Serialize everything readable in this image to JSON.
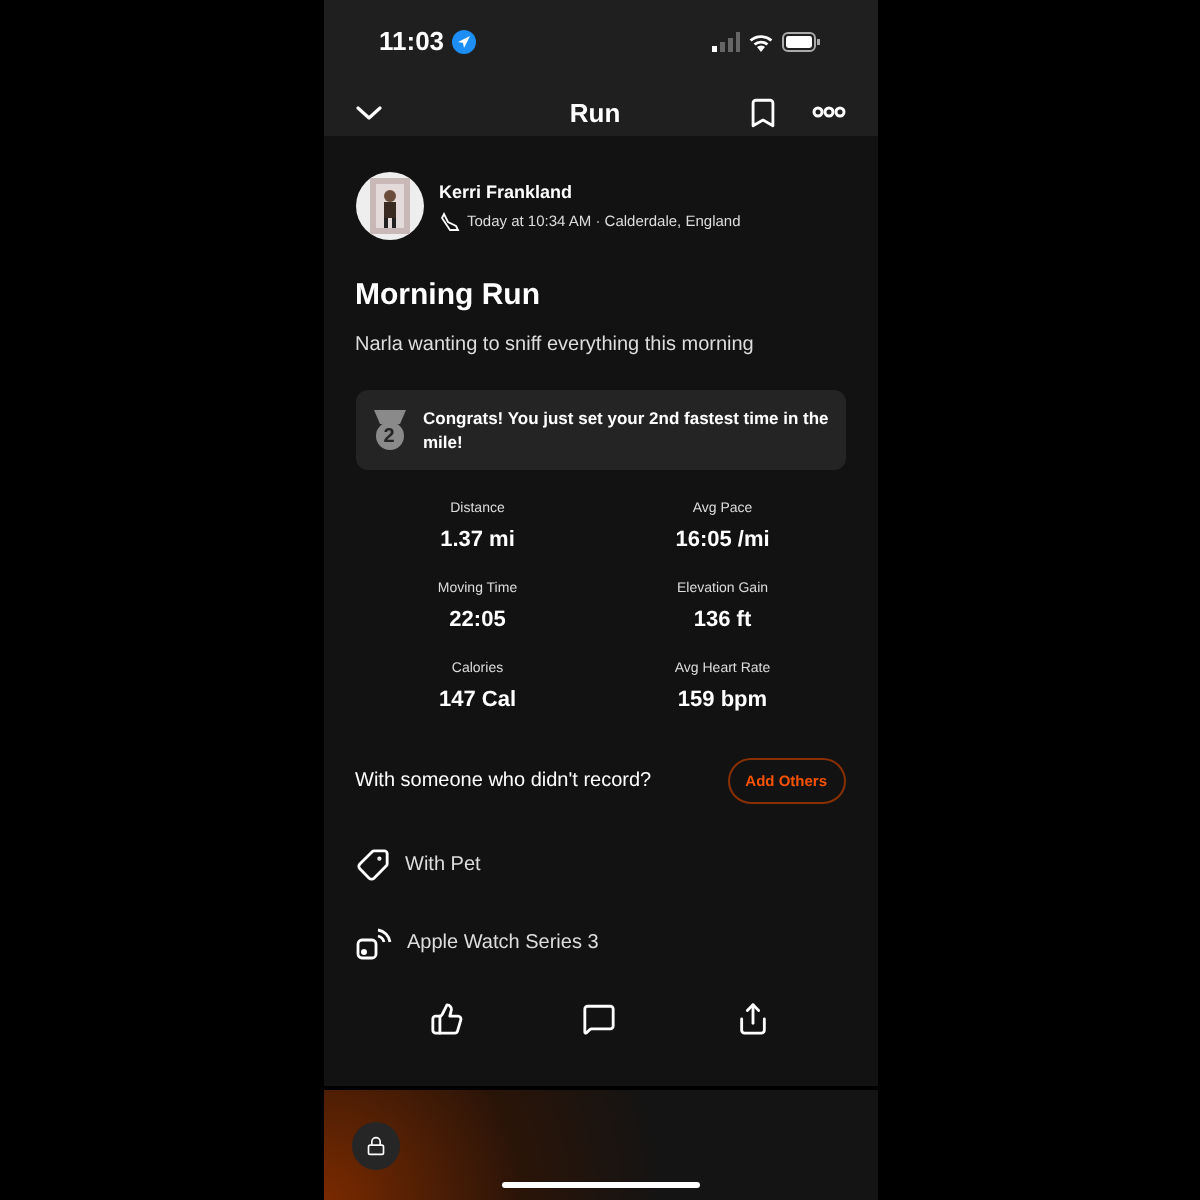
{
  "status_bar": {
    "time": "11:03"
  },
  "header": {
    "title": "Run"
  },
  "athlete": {
    "name": "Kerri Frankland",
    "meta": "Today at 10:34 AM · Calderdale, England"
  },
  "activity": {
    "title": "Morning Run",
    "description": "Narla wanting to sniff everything this morning"
  },
  "achievement": {
    "rank": "2",
    "text": "Congrats! You just set your 2nd fastest time in the mile!"
  },
  "stats": [
    {
      "label": "Distance",
      "value": "1.37 mi"
    },
    {
      "label": "Avg Pace",
      "value": "16:05 /mi"
    },
    {
      "label": "Moving Time",
      "value": "22:05"
    },
    {
      "label": "Elevation Gain",
      "value": "136 ft"
    },
    {
      "label": "Calories",
      "value": "147 Cal"
    },
    {
      "label": "Avg Heart Rate",
      "value": "159 bpm"
    }
  ],
  "add_others": {
    "prompt": "With someone who didn't record?",
    "button": "Add Others"
  },
  "details": [
    {
      "kind": "tag",
      "text": "With Pet"
    },
    {
      "kind": "device",
      "text": "Apple Watch Series 3"
    }
  ]
}
